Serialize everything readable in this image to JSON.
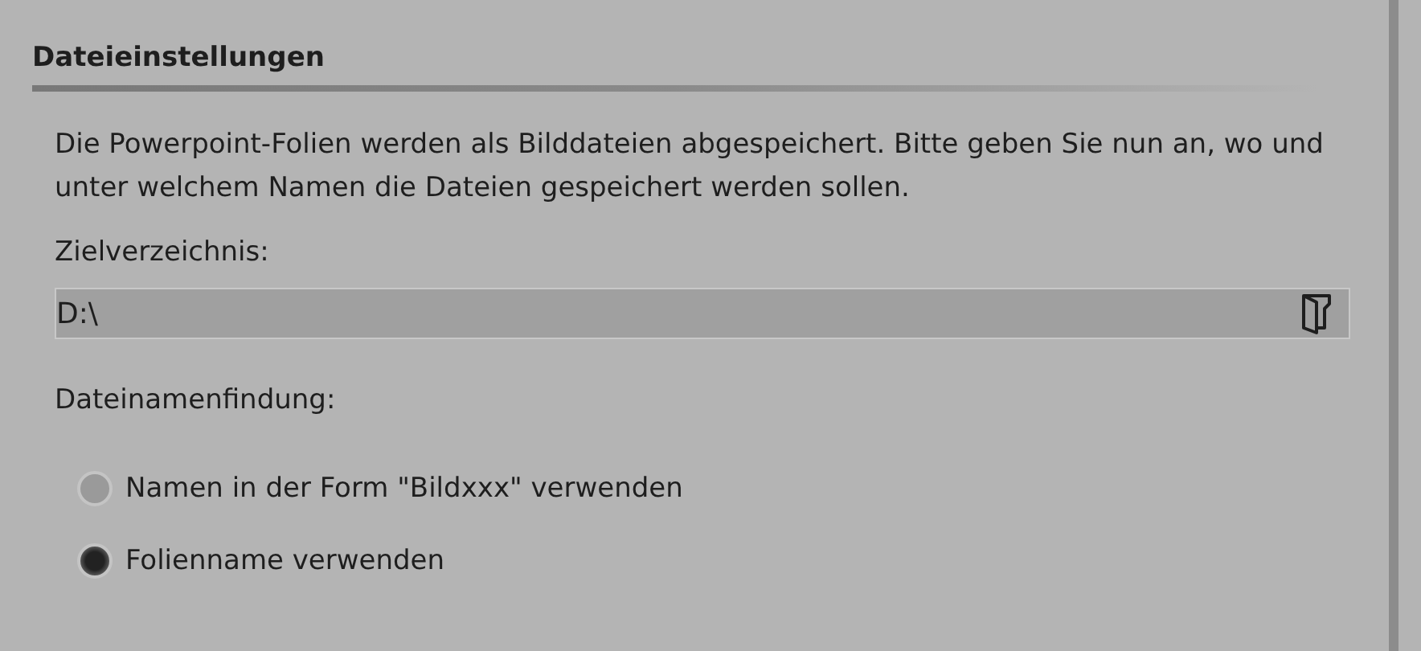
{
  "section": {
    "title": "Dateieinstellungen",
    "description": "Die Powerpoint-Folien werden als Bilddateien abgespeichert. Bitte geben Sie nun an, wo und unter welchem Namen die Dateien gespeichert werden sollen."
  },
  "target_folder": {
    "label": "Zielverzeichnis:",
    "value": "D:\\"
  },
  "naming": {
    "label": "Dateinamenfindung:",
    "options": [
      {
        "label": "Namen in der Form \"Bildxxx\" verwenden",
        "selected": false
      },
      {
        "label": "Folienname verwenden",
        "selected": true
      }
    ]
  }
}
